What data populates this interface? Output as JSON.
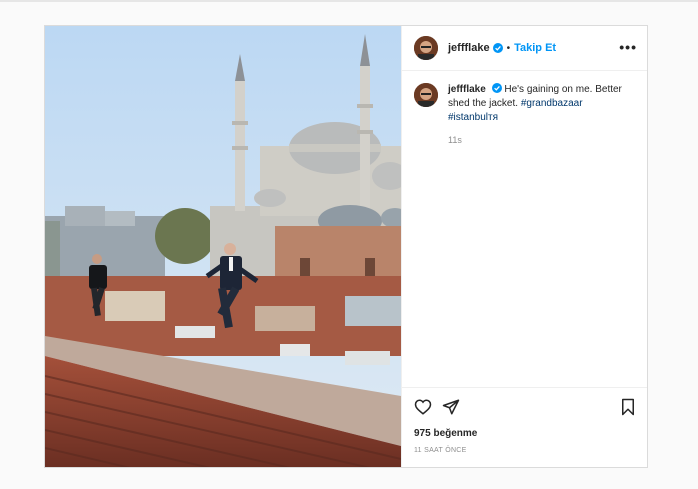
{
  "post": {
    "username": "jeffflake",
    "follow_label": "Takip Et",
    "dot": "•",
    "more_label": "•••",
    "caption_text": "He's gaining on me. Better shed the jacket.",
    "hashtags": [
      "#grandbazaar",
      "#istanbul"
    ],
    "hashtag_suffix": "тя",
    "caption_age": "11s",
    "likes": "975 beğenme",
    "posted_ago": "11 SAAT ÖNCE"
  },
  "icons": {
    "verified": "verified-badge-icon",
    "like": "heart-icon",
    "share": "paper-plane-icon",
    "save": "bookmark-icon",
    "more": "more-options-icon"
  },
  "colors": {
    "accent": "#0095f6",
    "hashtag": "#00376b",
    "muted": "#8e8e8e"
  }
}
